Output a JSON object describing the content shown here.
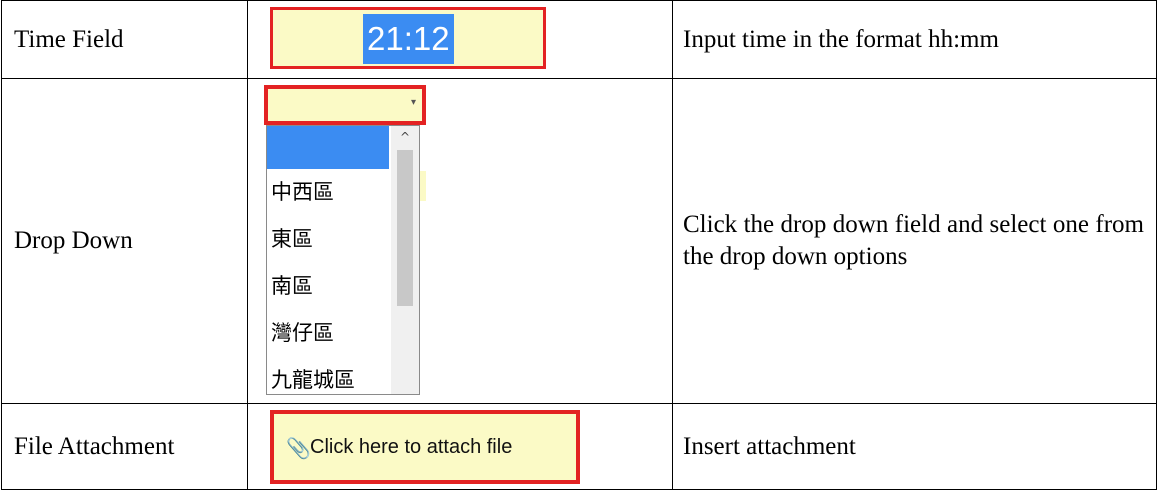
{
  "rows": [
    {
      "label": "Time Field",
      "description": "Input time in the format hh:mm"
    },
    {
      "label": "Drop Down",
      "description": "Click the drop down field and select one from the drop down options"
    },
    {
      "label": "File Attachment",
      "description": "Insert attachment"
    }
  ],
  "time_field": {
    "value": "21:12"
  },
  "drop_down": {
    "selected": "",
    "options": [
      "",
      "中西區",
      "東區",
      "南區",
      "灣仔區",
      "九龍城區"
    ]
  },
  "file_attachment": {
    "label": "Click here to attach file",
    "icon": "paperclip-icon"
  },
  "colors": {
    "field_bg": "#fbfac6",
    "highlight_border": "#e32222",
    "selection": "#3b8cf2"
  }
}
